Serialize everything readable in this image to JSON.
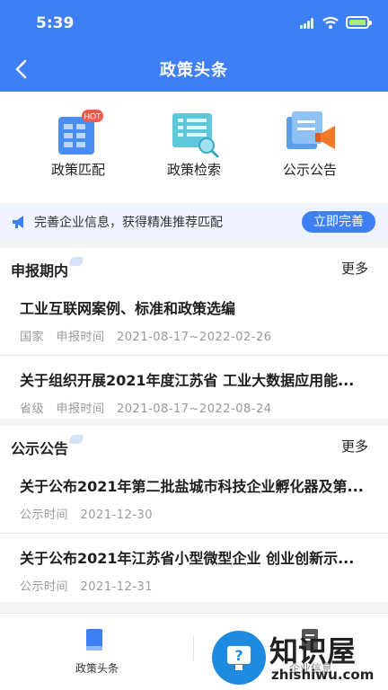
{
  "status": {
    "time": "5:39"
  },
  "nav": {
    "title": "政策头条"
  },
  "quick": [
    {
      "label": "政策匹配",
      "badge": "HOT"
    },
    {
      "label": "政策检索"
    },
    {
      "label": "公示公告"
    }
  ],
  "banner": {
    "text": "完善企业信息，获得精准推荐匹配",
    "button": "立即完善"
  },
  "sections": [
    {
      "title": "申报期内",
      "more": "更多",
      "items": [
        {
          "title": "工业互联网案例、标准和政策选编",
          "meta": "国家　申报时间　2021-08-17~2022-02-26"
        },
        {
          "title": "关于组织开展2021年度江苏省 工业大数据应用能...",
          "meta": "省级　申报时间　2021-08-17~2022-08-24"
        }
      ]
    },
    {
      "title": "公示公告",
      "more": "更多",
      "items": [
        {
          "title": "关于公布2021年第二批盐城市科技企业孵化器及第...",
          "meta": "公示时间　2021-12-30"
        },
        {
          "title": "关于公布2021年江苏省小型微型企业 创业创新示...",
          "meta": "公示时间　2021-12-31"
        }
      ]
    }
  ],
  "tabbar": [
    {
      "label": "政策头条",
      "active": true
    },
    {
      "label": "企业信息",
      "active": false
    }
  ],
  "watermark": {
    "brand": "知识屋",
    "url": "zhishiwu.com"
  },
  "colors": {
    "primary": "#3f7ff5",
    "banner_bg": "#eef3fd",
    "hot_badge": "#f05a4b"
  }
}
